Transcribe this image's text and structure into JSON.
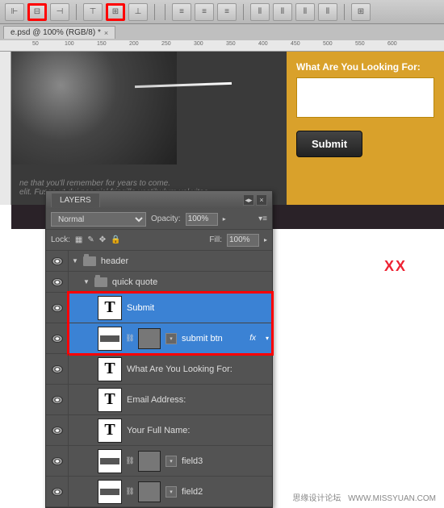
{
  "tab": {
    "title": "e.psd @ 100% (RGB/8) *"
  },
  "ruler": {
    "marks": [
      "50",
      "100",
      "150",
      "200",
      "250",
      "300",
      "350",
      "400",
      "450",
      "500",
      "550",
      "600"
    ]
  },
  "hero": {
    "line1": "ne that you'll remember for years to come.",
    "line2": "elit. Fusce ut dui nec nisl fringilla vestibulum vel vitae"
  },
  "quote": {
    "label": "What Are You Looking For:",
    "submit": "Submit"
  },
  "panel": {
    "tab": "LAYERS",
    "blend_mode": "Normal",
    "opacity_label": "Opacity:",
    "opacity_value": "100%",
    "lock_label": "Lock:",
    "fill_label": "Fill:",
    "fill_value": "100%"
  },
  "layers": {
    "header": "header",
    "quick_quote": "quick quote",
    "submit_text": "Submit",
    "submit_btn": "submit btn",
    "fx": "fx",
    "looking": "What Are You Looking For:",
    "email": "Email Address:",
    "fullname": "Your Full Name:",
    "field3": "field3",
    "field2": "field2"
  },
  "watermark": {
    "cn": "思缘设计论坛",
    "url": "WWW.MISSYUAN.COM"
  },
  "xx": "XX"
}
